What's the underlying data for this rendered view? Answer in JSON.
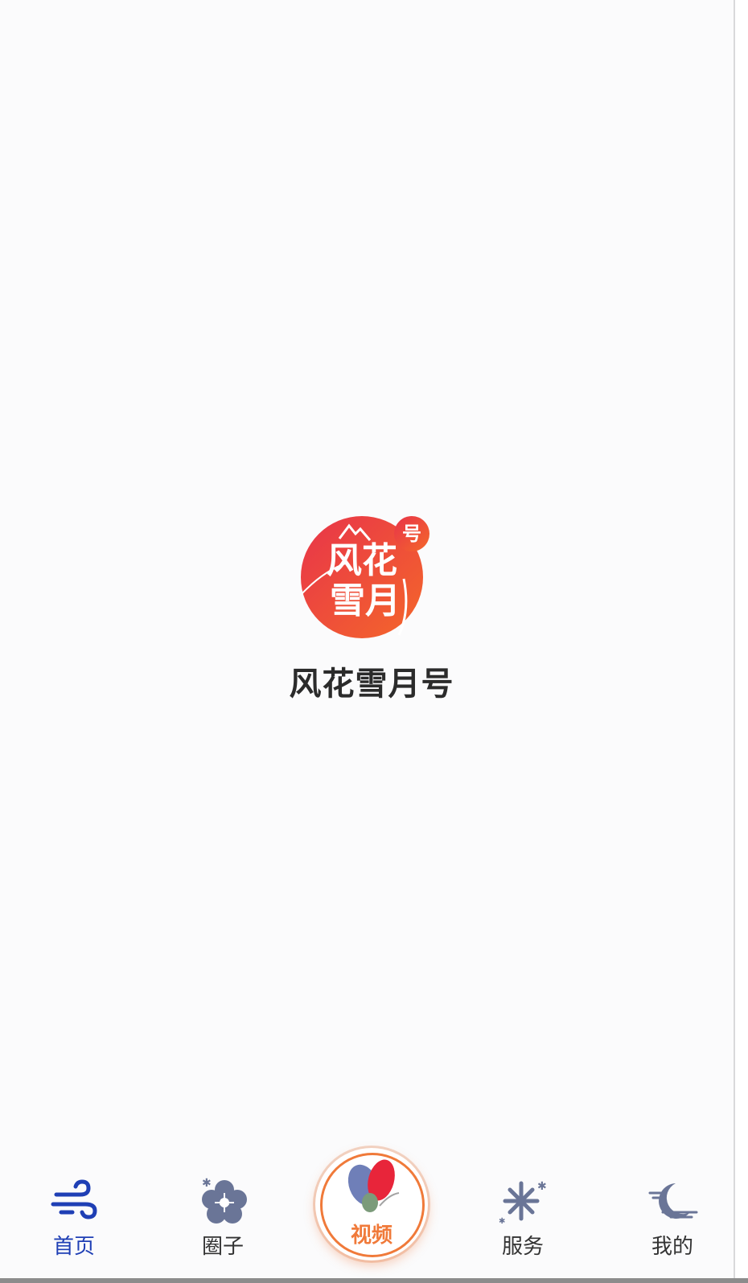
{
  "splash": {
    "app_name": "风花雪月号",
    "logo": {
      "text_main": "风花雪月",
      "badge": "号",
      "colors": {
        "gradient_start": "#e8344a",
        "gradient_end": "#f4672a",
        "text": "#ffffff"
      }
    }
  },
  "tabbar": {
    "active_color": "#1f3fb5",
    "inactive_color": "#333333",
    "accent_color": "#f07a3a",
    "items": [
      {
        "label": "首页",
        "icon": "wind-icon",
        "active": true
      },
      {
        "label": "圈子",
        "icon": "flower-icon",
        "active": false
      },
      {
        "label": "视频",
        "icon": "butterfly-icon",
        "active": false
      },
      {
        "label": "服务",
        "icon": "snowflake-icon",
        "active": false
      },
      {
        "label": "我的",
        "icon": "moon-icon",
        "active": false
      }
    ]
  }
}
